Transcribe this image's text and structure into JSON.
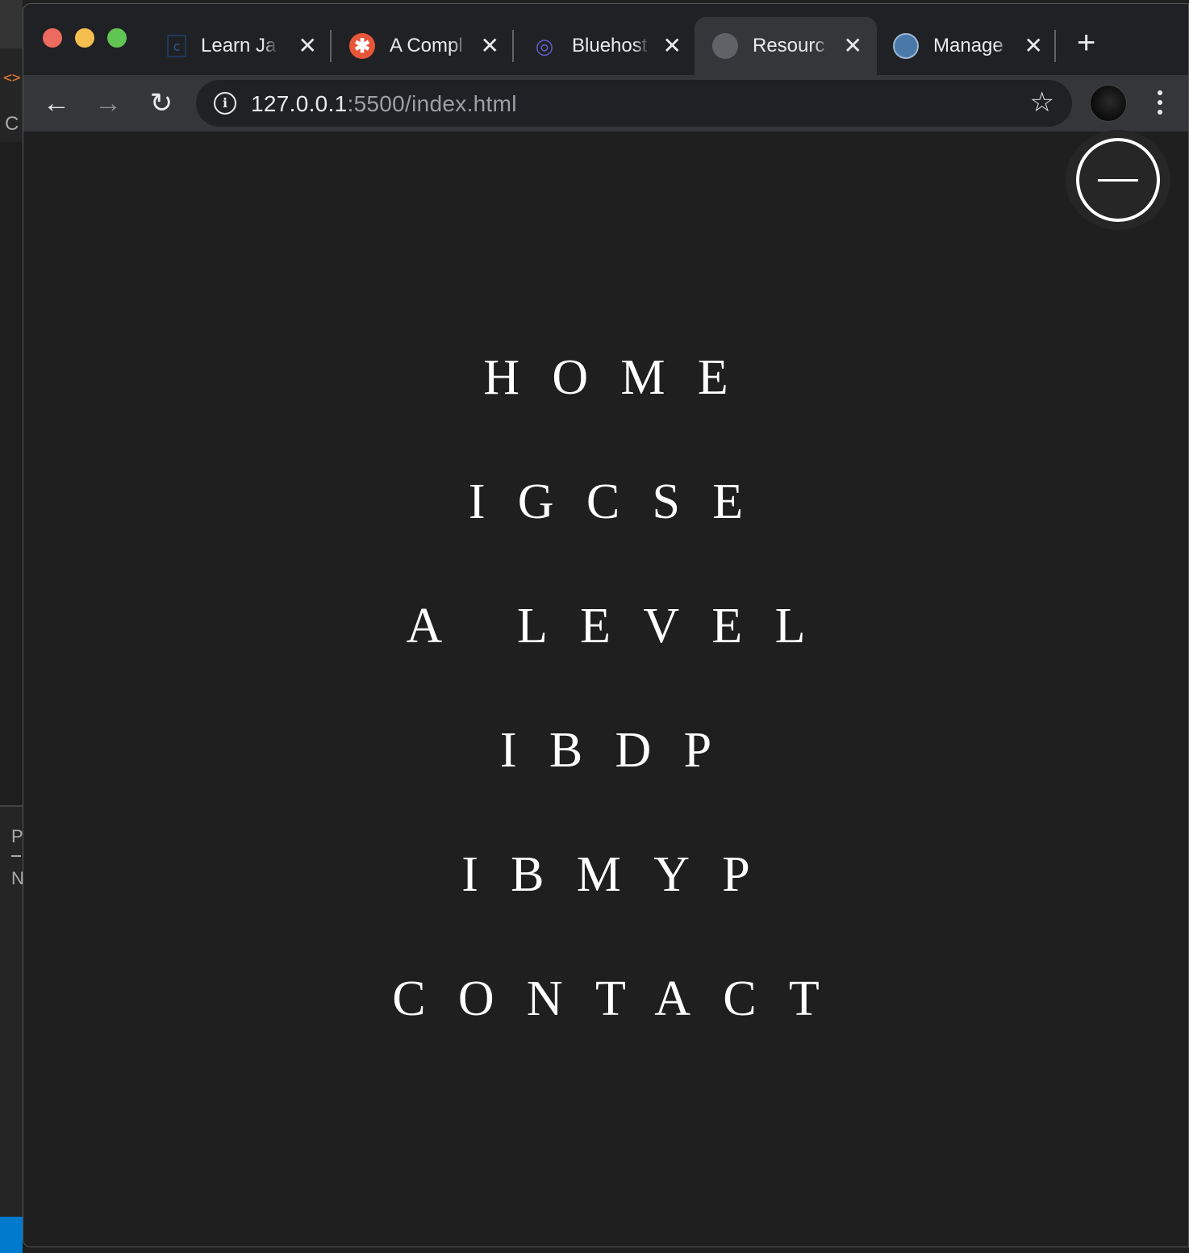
{
  "tabs": [
    {
      "title": "Learn Ja",
      "icon": "codecademy-icon",
      "active": false
    },
    {
      "title": "A Compl",
      "icon": "asterisk-logo-icon",
      "active": false
    },
    {
      "title": "Bluehost",
      "icon": "bluehost-planet-icon",
      "active": false
    },
    {
      "title": "Resourc",
      "icon": "globe-icon",
      "active": true
    },
    {
      "title": "Manage",
      "icon": "wordpress-icon",
      "active": false
    }
  ],
  "address_bar": {
    "host": "127.0.0.1",
    "rest": ":5500/index.html"
  },
  "menu": {
    "items": [
      "HOME",
      "IGCSE",
      "A LEVEL",
      "IBDP",
      "IBMYP",
      "CONTACT"
    ]
  },
  "colors": {
    "page_background": "#1f1f1f",
    "menu_text": "#ffffff",
    "chrome_tabbar": "#202124",
    "chrome_toolbar": "#35363a"
  }
}
